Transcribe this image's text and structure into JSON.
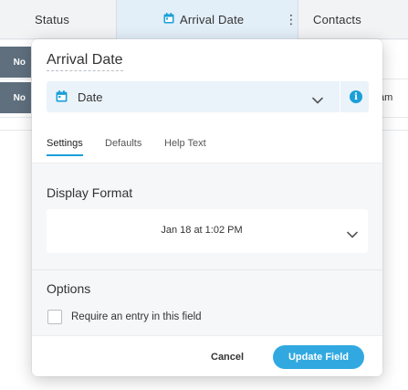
{
  "grid": {
    "columns": {
      "status": "Status",
      "arrival_date": "Arrival Date",
      "contacts": "Contacts"
    },
    "kebab": "⋮",
    "status_chips": [
      "No",
      "No"
    ],
    "peek_text": "am"
  },
  "modal": {
    "title": "Arrival Date",
    "field_type": "Date",
    "tabs": [
      "Settings",
      "Defaults",
      "Help Text"
    ],
    "active_tab": "Settings",
    "display_format_label": "Display Format",
    "display_format_value": "Jan 18 at 1:02 PM",
    "options_label": "Options",
    "require_entry_label": "Require an entry in this field",
    "require_entry_checked": false,
    "cancel_label": "Cancel",
    "update_label": "Update Field"
  },
  "icons": [
    "calendar-icon",
    "vertical-dots-icon",
    "chevron-down-icon",
    "info-icon"
  ],
  "colors": {
    "accent": "#31a9e0",
    "type_bar": "#eaf3fa",
    "status_chip": "#5f6f7e",
    "active_header": "#e2eef8"
  }
}
